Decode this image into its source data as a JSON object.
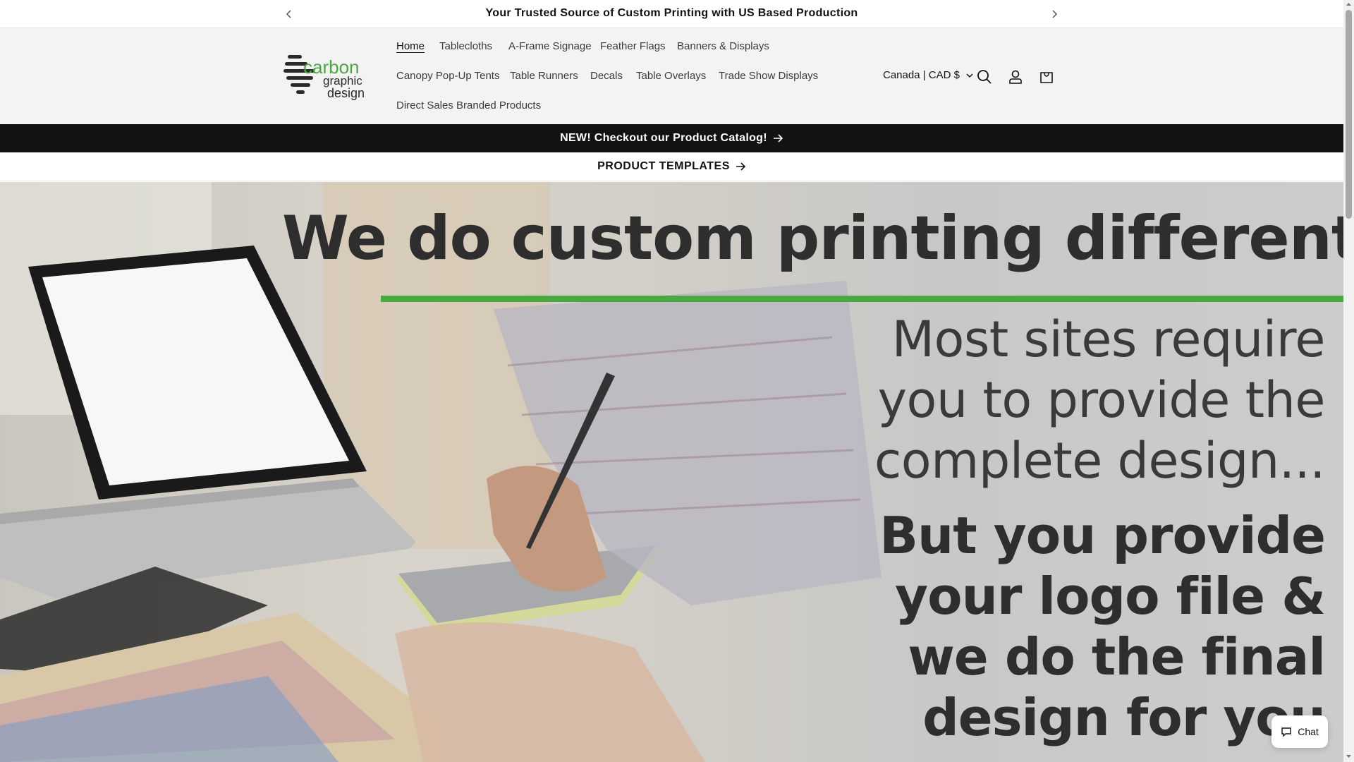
{
  "announcement": {
    "message": "Your Trusted Source of Custom Printing with US Based Production",
    "prev_icon": "chevron-left-icon",
    "next_icon": "chevron-right-icon"
  },
  "header": {
    "logo": {
      "word1": "carbon",
      "word2": "graphic",
      "word3": "design"
    },
    "nav": [
      {
        "label": "Home",
        "active": true
      },
      {
        "label": "Tablecloths"
      },
      {
        "label": "A-Frame Signage"
      },
      {
        "label": "Feather Flags"
      },
      {
        "label": "Banners & Displays"
      },
      {
        "label": "Canopy Pop-Up Tents"
      },
      {
        "label": "Table Runners"
      },
      {
        "label": "Decals"
      },
      {
        "label": "Table Overlays"
      },
      {
        "label": "Trade Show Displays"
      },
      {
        "label": "Direct Sales Branded Products"
      }
    ],
    "country_selector": "Canada | CAD $",
    "icons": [
      "search-icon",
      "account-icon",
      "cart-icon"
    ]
  },
  "promos": {
    "catalog": "NEW! Checkout our Product Catalog!",
    "templates": "PRODUCT TEMPLATES"
  },
  "hero": {
    "title": "We do custom printing differently",
    "sub_lines": [
      "Most sites require",
      "you to provide the",
      "complete design..."
    ],
    "bold_lines": [
      "But you provide",
      "your logo file &",
      "we do the final",
      "design for you"
    ]
  },
  "chat": {
    "label": "Chat"
  },
  "colors": {
    "accent_green": "#49a83f",
    "dark": "#121212"
  }
}
